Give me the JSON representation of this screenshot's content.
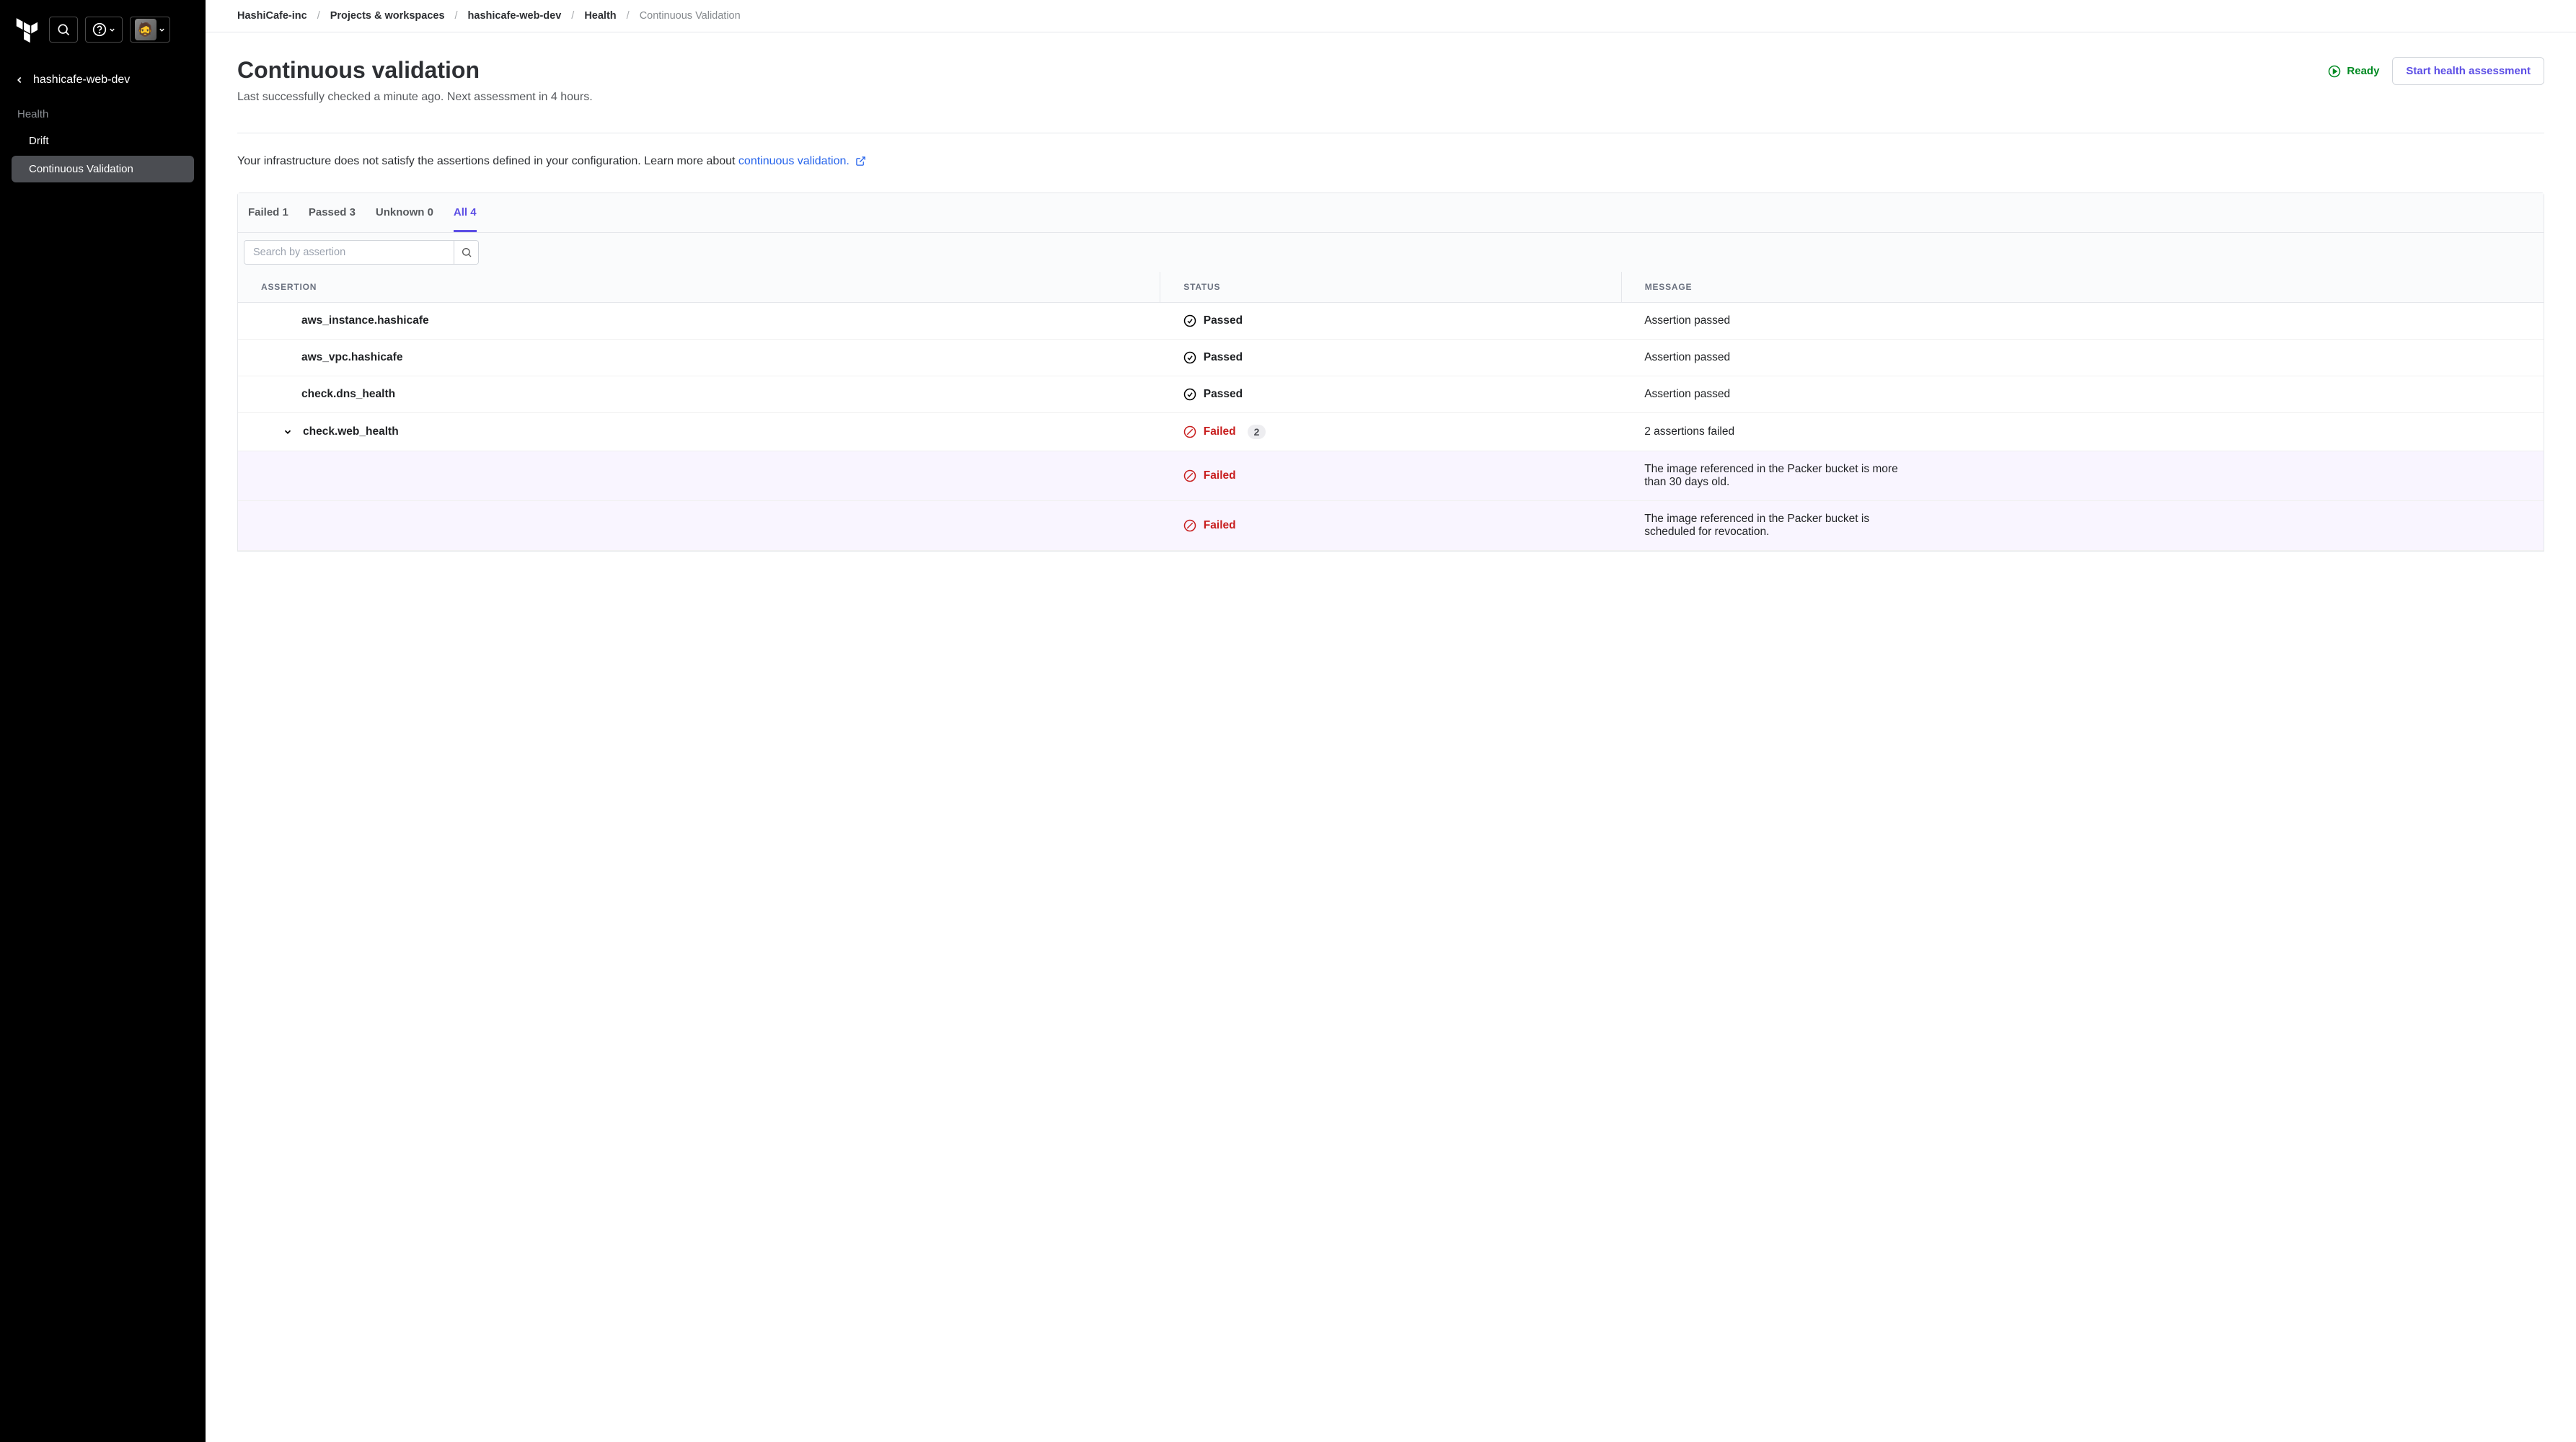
{
  "sidebar": {
    "workspace_name": "hashicafe-web-dev",
    "section_label": "Health",
    "items": [
      {
        "label": "Drift",
        "active": false
      },
      {
        "label": "Continuous Validation",
        "active": true
      }
    ]
  },
  "breadcrumbs": [
    {
      "label": "HashiCafe-inc",
      "current": false
    },
    {
      "label": "Projects & workspaces",
      "current": false
    },
    {
      "label": "hashicafe-web-dev",
      "current": false
    },
    {
      "label": "Health",
      "current": false
    },
    {
      "label": "Continuous Validation",
      "current": true
    }
  ],
  "header": {
    "title": "Continuous validation",
    "subtitle": "Last successfully checked a minute ago. Next assessment in 4 hours.",
    "status_label": "Ready",
    "button_label": "Start health assessment"
  },
  "info": {
    "text": "Your infrastructure does not satisfy the assertions defined in your configuration. Learn more about ",
    "link_label": "continuous validation."
  },
  "tabs": [
    {
      "label": "Failed 1",
      "active": false
    },
    {
      "label": "Passed 3",
      "active": false
    },
    {
      "label": "Unknown 0",
      "active": false
    },
    {
      "label": "All 4",
      "active": true
    }
  ],
  "search": {
    "placeholder": "Search by assertion"
  },
  "table": {
    "headers": {
      "assertion": "ASSERTION",
      "status": "STATUS",
      "message": "MESSAGE"
    },
    "rows": [
      {
        "type": "leaf",
        "assertion": "aws_instance.hashicafe",
        "status": "Passed",
        "message": "Assertion passed"
      },
      {
        "type": "leaf",
        "assertion": "aws_vpc.hashicafe",
        "status": "Passed",
        "message": "Assertion passed"
      },
      {
        "type": "leaf",
        "assertion": "check.dns_health",
        "status": "Passed",
        "message": "Assertion passed"
      },
      {
        "type": "group",
        "assertion": "check.web_health",
        "status": "Failed",
        "badge": "2",
        "message": "2 assertions failed"
      },
      {
        "type": "sub",
        "status": "Failed",
        "message": "The image referenced in the Packer bucket is more than 30 days old."
      },
      {
        "type": "sub",
        "status": "Failed",
        "message": "The image referenced in the Packer bucket is scheduled for revocation."
      }
    ]
  }
}
